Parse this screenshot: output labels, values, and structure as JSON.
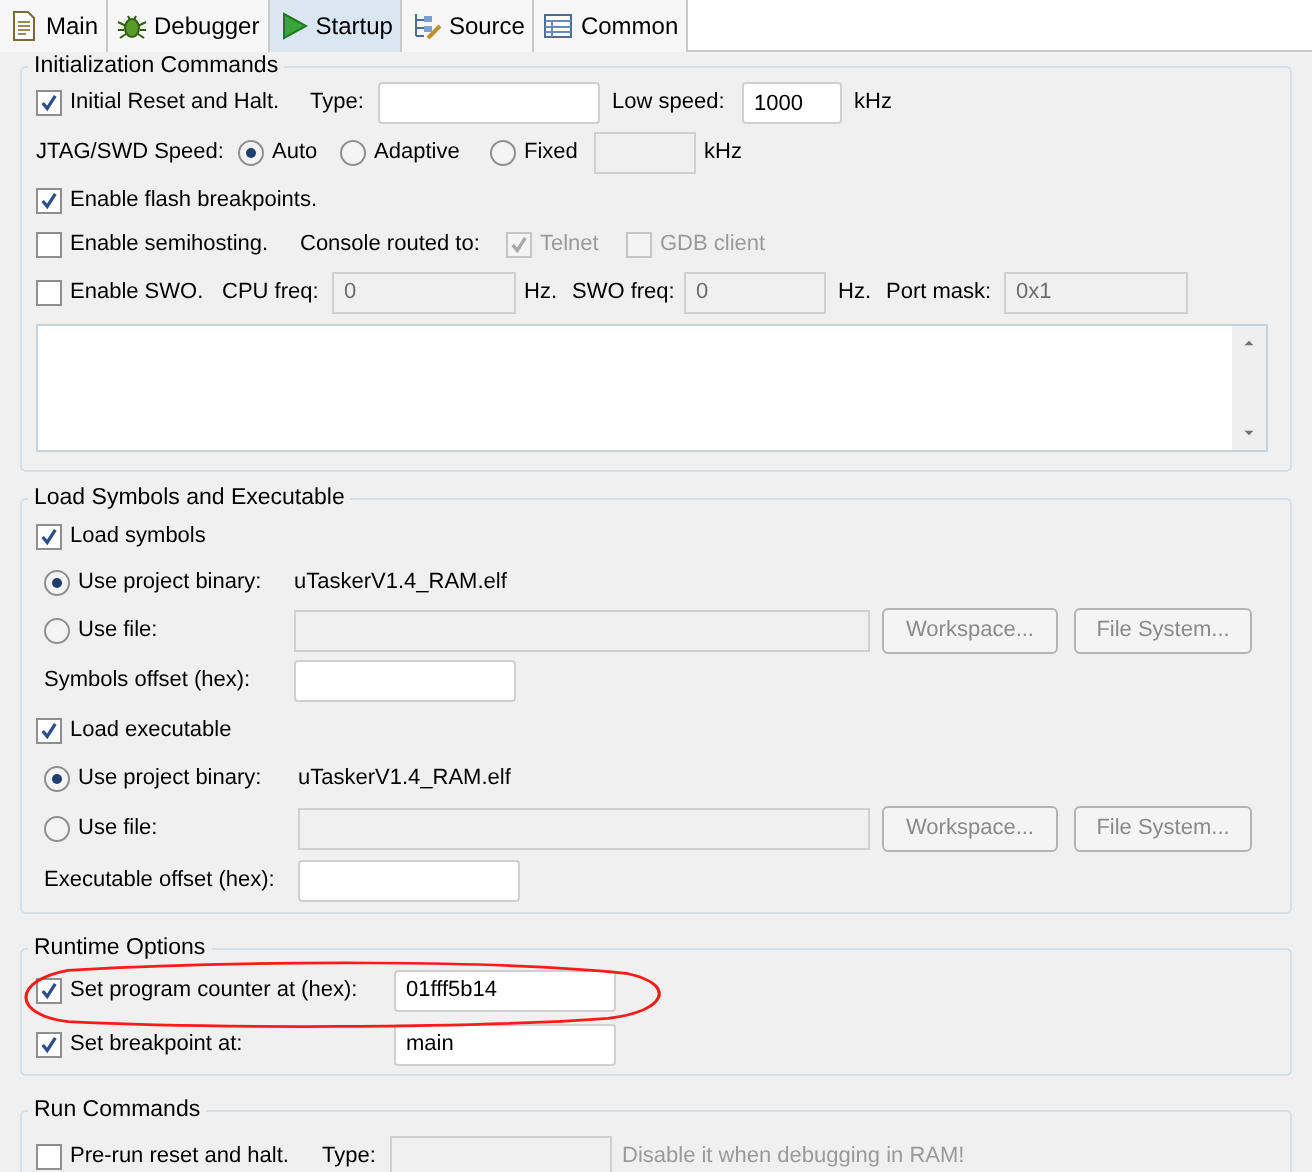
{
  "tabs": [
    {
      "label": "Main",
      "selected": false
    },
    {
      "label": "Debugger",
      "selected": false
    },
    {
      "label": "Startup",
      "selected": true
    },
    {
      "label": "Source",
      "selected": false
    },
    {
      "label": "Common",
      "selected": false
    }
  ],
  "sections": [
    {
      "title": "Initialization Commands",
      "rows": [
        {
          "items": [
            {
              "kind": "checkbox",
              "label": "Initial Reset and Halt.",
              "checked": true,
              "disabled": false
            },
            {
              "kind": "text",
              "text": "Type:"
            },
            {
              "kind": "field",
              "disabled": false
            },
            {
              "kind": "text",
              "text": "Low speed:"
            },
            {
              "kind": "field",
              "value": "1000",
              "disabled": false
            },
            {
              "kind": "text",
              "text": "kHz"
            }
          ]
        },
        {
          "items": [
            {
              "kind": "text",
              "text": "JTAG/SWD Speed:"
            },
            {
              "kind": "radio",
              "label": "Auto",
              "selected": true
            },
            {
              "kind": "radio",
              "label": "Adaptive",
              "selected": false
            },
            {
              "kind": "radio",
              "label": "Fixed",
              "selected": false
            },
            {
              "kind": "field",
              "disabled": true
            },
            {
              "kind": "text",
              "text": "kHz"
            }
          ]
        },
        {
          "items": [
            {
              "kind": "checkbox",
              "label": "Enable flash breakpoints.",
              "checked": true,
              "disabled": false
            }
          ]
        },
        {
          "items": [
            {
              "kind": "checkbox",
              "label": "Enable semihosting.",
              "checked": false,
              "disabled": false
            },
            {
              "kind": "text",
              "text": "Console routed to:"
            },
            {
              "kind": "checkbox",
              "label": "Telnet",
              "checked": true,
              "disabled": true
            },
            {
              "kind": "checkbox",
              "label": "GDB client",
              "checked": false,
              "disabled": true
            }
          ]
        },
        {
          "items": [
            {
              "kind": "checkbox",
              "label": "Enable SWO.",
              "checked": false,
              "disabled": false
            },
            {
              "kind": "text",
              "text": "CPU freq:"
            },
            {
              "kind": "field",
              "value": "0",
              "disabled": true
            },
            {
              "kind": "text",
              "text": "Hz."
            },
            {
              "kind": "text",
              "text": "SWO freq:"
            },
            {
              "kind": "field",
              "value": "0",
              "disabled": true
            },
            {
              "kind": "text",
              "text": "Hz."
            },
            {
              "kind": "text",
              "text": "Port mask:"
            },
            {
              "kind": "field",
              "value": "0x1",
              "disabled": true
            }
          ]
        },
        {
          "items": [
            {
              "kind": "textarea"
            }
          ]
        }
      ]
    },
    {
      "title": "Load Symbols and Executable",
      "rows": [
        {
          "items": [
            {
              "kind": "checkbox",
              "label": "Load symbols",
              "checked": true,
              "disabled": false
            }
          ]
        },
        {
          "items": [
            {
              "kind": "radio",
              "label": "Use project binary:",
              "selected": true
            },
            {
              "kind": "text",
              "text": "uTaskerV1.4_RAM.elf"
            }
          ]
        },
        {
          "items": [
            {
              "kind": "radio",
              "label": "Use file:",
              "selected": false
            },
            {
              "kind": "field",
              "disabled": true
            },
            {
              "kind": "button",
              "label": "Workspace...",
              "disabled": true
            },
            {
              "kind": "button",
              "label": "File System...",
              "disabled": true
            }
          ]
        },
        {
          "items": [
            {
              "kind": "text",
              "text": "Symbols offset (hex):"
            },
            {
              "kind": "field",
              "disabled": false
            }
          ]
        },
        {
          "items": [
            {
              "kind": "checkbox",
              "label": "Load executable",
              "checked": true,
              "disabled": false
            }
          ]
        },
        {
          "items": [
            {
              "kind": "radio",
              "label": "Use project binary:",
              "selected": true
            },
            {
              "kind": "text",
              "text": "uTaskerV1.4_RAM.elf"
            }
          ]
        },
        {
          "items": [
            {
              "kind": "radio",
              "label": "Use file:",
              "selected": false
            },
            {
              "kind": "field",
              "disabled": true
            },
            {
              "kind": "button",
              "label": "Workspace...",
              "disabled": true
            },
            {
              "kind": "button",
              "label": "File System...",
              "disabled": true
            }
          ]
        },
        {
          "items": [
            {
              "kind": "text",
              "text": "Executable offset (hex):"
            },
            {
              "kind": "field",
              "disabled": false
            }
          ]
        }
      ]
    },
    {
      "title": "Runtime Options",
      "rows": [
        {
          "items": [
            {
              "kind": "checkbox",
              "label": "Set program counter at (hex):",
              "checked": true,
              "disabled": false
            },
            {
              "kind": "field",
              "value": "01fff5b14",
              "disabled": false
            }
          ]
        },
        {
          "items": [
            {
              "kind": "checkbox",
              "label": "Set breakpoint at:",
              "checked": true,
              "disabled": false
            },
            {
              "kind": "field",
              "value": "main",
              "disabled": false
            }
          ]
        }
      ]
    },
    {
      "title": "Run Commands",
      "rows": [
        {
          "items": [
            {
              "kind": "checkbox",
              "label": "Pre-run reset and halt.",
              "checked": false,
              "disabled": false
            },
            {
              "kind": "text",
              "text": "Type:"
            },
            {
              "kind": "field",
              "disabled": true
            },
            {
              "kind": "hint",
              "text": "Disable it when debugging in RAM!"
            }
          ]
        }
      ]
    }
  ]
}
